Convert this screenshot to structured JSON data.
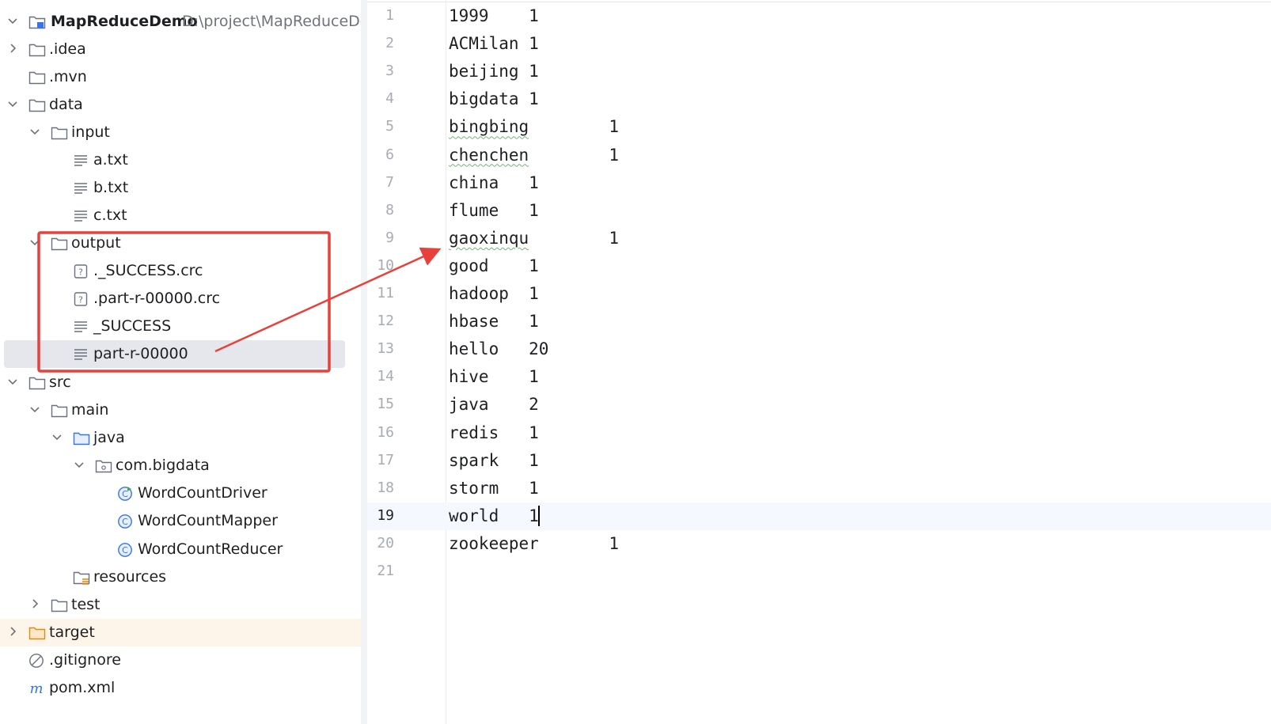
{
  "project_tree": {
    "root": {
      "name": "MapReduceDemo",
      "path": "D:\\project\\MapReduceDem"
    },
    "items": [
      {
        "label": ".idea",
        "icon": "folder-icon",
        "chevron": "right"
      },
      {
        "label": ".mvn",
        "icon": "folder-icon",
        "chevron": "none"
      },
      {
        "label": "data",
        "icon": "folder-icon",
        "chevron": "down"
      },
      {
        "label": "input",
        "icon": "folder-icon",
        "chevron": "down"
      },
      {
        "label": "a.txt",
        "icon": "text-file-icon",
        "chevron": "none"
      },
      {
        "label": "b.txt",
        "icon": "text-file-icon",
        "chevron": "none"
      },
      {
        "label": "c.txt",
        "icon": "text-file-icon",
        "chevron": "none"
      },
      {
        "label": "output",
        "icon": "folder-icon",
        "chevron": "down"
      },
      {
        "label": "._SUCCESS.crc",
        "icon": "unknown-file-icon",
        "chevron": "none"
      },
      {
        "label": ".part-r-00000.crc",
        "icon": "unknown-file-icon",
        "chevron": "none"
      },
      {
        "label": "_SUCCESS",
        "icon": "text-file-icon",
        "chevron": "none"
      },
      {
        "label": "part-r-00000",
        "icon": "text-file-icon",
        "chevron": "none",
        "selected": true
      },
      {
        "label": "src",
        "icon": "folder-icon",
        "chevron": "down"
      },
      {
        "label": "main",
        "icon": "folder-icon",
        "chevron": "down"
      },
      {
        "label": "java",
        "icon": "source-folder-icon",
        "chevron": "down"
      },
      {
        "label": "com.bigdata",
        "icon": "package-icon",
        "chevron": "down"
      },
      {
        "label": "WordCountDriver",
        "icon": "runnable-class-icon",
        "chevron": "none"
      },
      {
        "label": "WordCountMapper",
        "icon": "class-icon",
        "chevron": "none"
      },
      {
        "label": "WordCountReducer",
        "icon": "class-icon",
        "chevron": "none"
      },
      {
        "label": "resources",
        "icon": "resources-folder-icon",
        "chevron": "none"
      },
      {
        "label": "test",
        "icon": "folder-icon",
        "chevron": "right"
      },
      {
        "label": "target",
        "icon": "excluded-folder-icon",
        "chevron": "right"
      },
      {
        "label": ".gitignore",
        "icon": "ignore-file-icon",
        "chevron": "none"
      },
      {
        "label": "pom.xml",
        "icon": "maven-icon",
        "chevron": "none"
      }
    ]
  },
  "editor": {
    "lines": [
      {
        "no": "1",
        "word": "1999",
        "count": "1"
      },
      {
        "no": "2",
        "word": "ACMilan",
        "count": "1"
      },
      {
        "no": "3",
        "word": "beijing",
        "count": "1"
      },
      {
        "no": "4",
        "word": "bigdata",
        "count": "1"
      },
      {
        "no": "5",
        "word": "bingbing",
        "count": "1"
      },
      {
        "no": "6",
        "word": "chenchen",
        "count": "1"
      },
      {
        "no": "7",
        "word": "china",
        "count": "1"
      },
      {
        "no": "8",
        "word": "flume",
        "count": "1"
      },
      {
        "no": "9",
        "word": "gaoxinqu",
        "count": "1"
      },
      {
        "no": "10",
        "word": "good",
        "count": "1"
      },
      {
        "no": "11",
        "word": "hadoop",
        "count": "1"
      },
      {
        "no": "12",
        "word": "hbase",
        "count": "1"
      },
      {
        "no": "13",
        "word": "hello",
        "count": "20"
      },
      {
        "no": "14",
        "word": "hive",
        "count": "1"
      },
      {
        "no": "15",
        "word": "java",
        "count": "2"
      },
      {
        "no": "16",
        "word": "redis",
        "count": "1"
      },
      {
        "no": "17",
        "word": "spark",
        "count": "1"
      },
      {
        "no": "18",
        "word": "storm",
        "count": "1"
      },
      {
        "no": "19",
        "word": "world",
        "count": "1"
      },
      {
        "no": "20",
        "word": "zookeeper",
        "count": "1"
      },
      {
        "no": "21",
        "word": "",
        "count": ""
      }
    ],
    "current_line": "19"
  },
  "annotation": {
    "color": "#e8413c"
  }
}
